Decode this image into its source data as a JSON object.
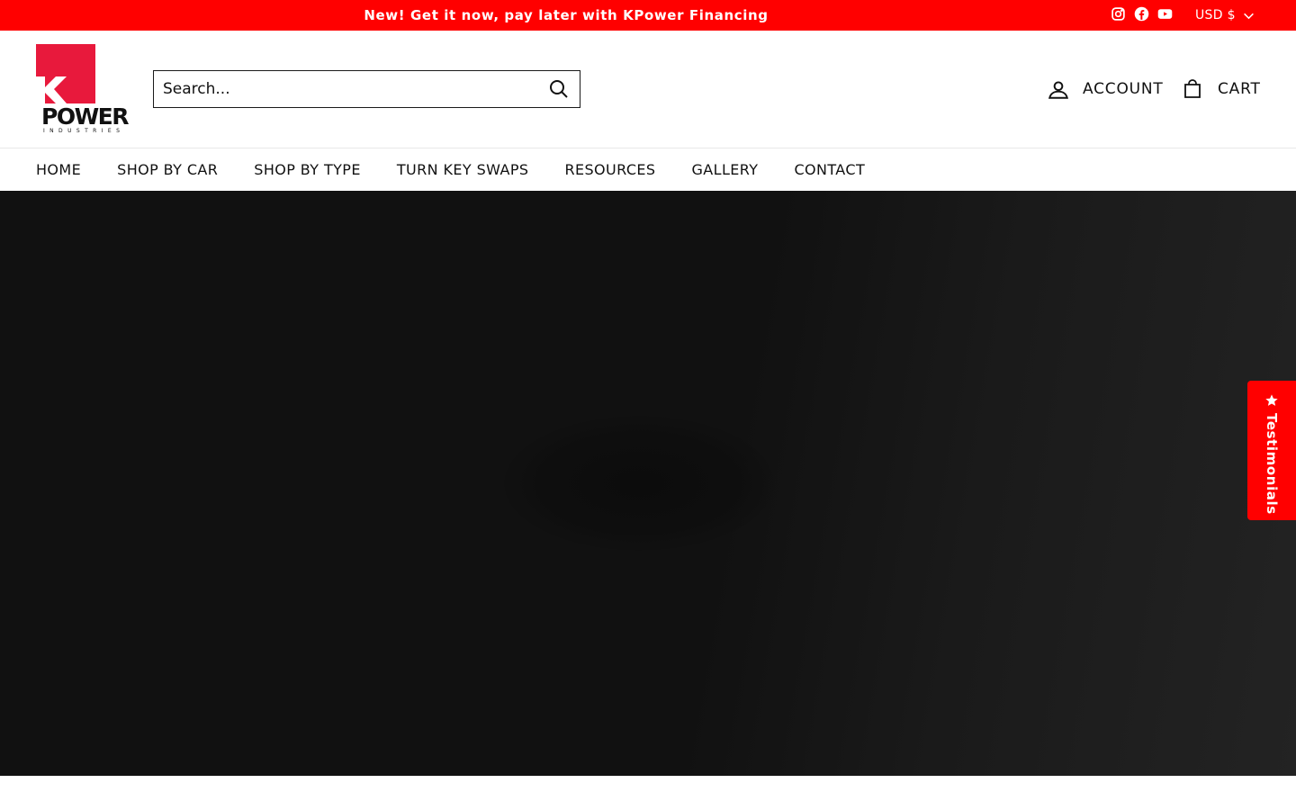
{
  "announcement": {
    "text": "New! Get it now, pay later with KPower Financing",
    "background": "#ff0000"
  },
  "social_links": [
    {
      "name": "instagram",
      "icon": "instagram-icon"
    },
    {
      "name": "facebook",
      "icon": "facebook-icon"
    },
    {
      "name": "youtube",
      "icon": "youtube-icon"
    }
  ],
  "currency": {
    "selected": "USD $"
  },
  "logo": {
    "word": "POWER",
    "letter": "K",
    "subtitle": "INDUSTRIES",
    "brand_color": "#e8193c"
  },
  "search": {
    "placeholder": "Search..."
  },
  "header": {
    "account_label": "ACCOUNT",
    "cart_label": "CART"
  },
  "nav": {
    "items": [
      {
        "label": "HOME"
      },
      {
        "label": "SHOP BY CAR"
      },
      {
        "label": "SHOP BY TYPE"
      },
      {
        "label": "TURN KEY SWAPS"
      },
      {
        "label": "RESOURCES"
      },
      {
        "label": "GALLERY"
      },
      {
        "label": "CONTACT"
      }
    ]
  },
  "testimonials_tab": {
    "label": "Testimonials",
    "icon": "star-icon"
  }
}
